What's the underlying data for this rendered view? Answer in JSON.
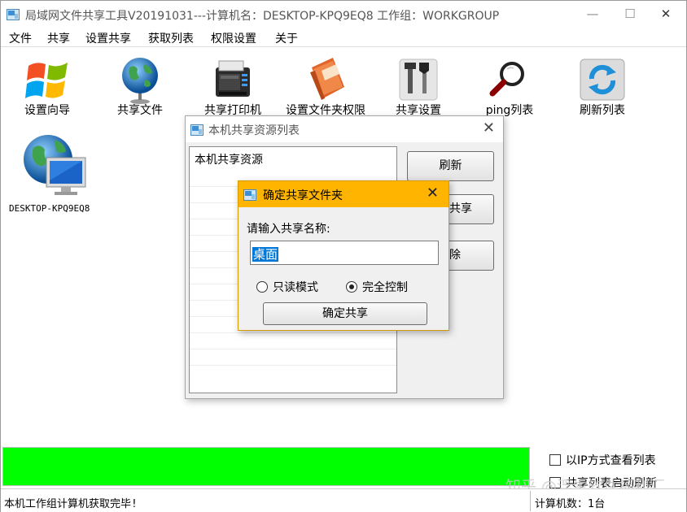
{
  "window": {
    "title": "局域网文件共享工具V20191031---计算机名：DESKTOP-KPQ9EQ8  工作组：WORKGROUP",
    "min_glyph": "—",
    "max_glyph": "☐",
    "close_glyph": "✕"
  },
  "menu": [
    "文件",
    "共享",
    "设置共享",
    "获取列表",
    "权限设置",
    "关于"
  ],
  "toolbar": [
    {
      "label": "设置向导",
      "icon": "windows-logo-icon"
    },
    {
      "label": "共享文件",
      "icon": "globe-icon"
    },
    {
      "label": "共享打印机",
      "icon": "printer-icon"
    },
    {
      "label": "设置文件夹权限",
      "icon": "address-book-icon"
    },
    {
      "label": "共享设置",
      "icon": "tools-icon"
    },
    {
      "label": "ping列表",
      "icon": "magnifier-icon"
    },
    {
      "label": "刷新列表",
      "icon": "refresh-icon"
    }
  ],
  "computers": [
    {
      "name": "DESKTOP-KPQ9EQ8"
    }
  ],
  "share_list_dialog": {
    "title": "本机共享资源列表",
    "list_header": "本机共享资源",
    "buttons": {
      "refresh": "刷新",
      "share": "共享",
      "delete": "除"
    }
  },
  "confirm_dialog": {
    "title": "确定共享文件夹",
    "prompt": "请输入共享名称:",
    "share_name": "桌面",
    "options": [
      {
        "label": "只读模式",
        "selected": false
      },
      {
        "label": "完全控制",
        "selected": true
      }
    ],
    "confirm_button": "确定共享"
  },
  "progress": {
    "percent": 100,
    "color": "#00ff00"
  },
  "options": {
    "ip_view_label": "以IP方式查看列表",
    "ip_view_checked": false,
    "second_option_label": "共享列表启动刷新",
    "second_option_checked": false
  },
  "status": {
    "message": "本机工作组计算机获取完毕!",
    "count": "计算机数：1台"
  },
  "watermark": "知乎 @浮生软件福利汇"
}
